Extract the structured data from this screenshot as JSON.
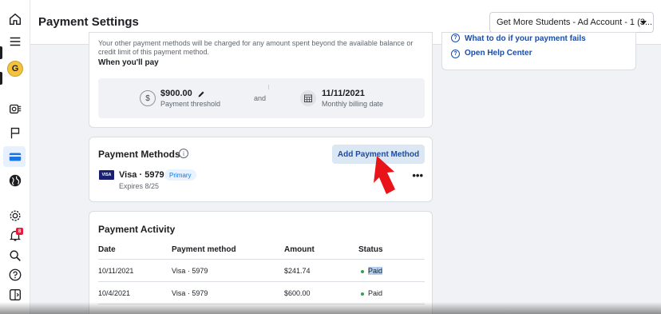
{
  "header": {
    "title": "Payment Settings",
    "account_selector": "Get More Students - Ad Account - 1 (3..."
  },
  "sidebar": {
    "avatar_letter": "G",
    "notification_count": "8"
  },
  "billing": {
    "note": "Your other payment methods will be charged for any amount spent beyond the available balance or credit limit of this payment method.",
    "when_heading": "When you'll pay",
    "threshold_value": "$900.00",
    "threshold_label": "Payment threshold",
    "and_text": "and",
    "date_value": "11/11/2021",
    "date_label": "Monthly billing date"
  },
  "help": {
    "link1": "What to do if your payment fails",
    "link2": "Open Help Center"
  },
  "payment_methods": {
    "title": "Payment Methods",
    "add_button": "Add Payment Method",
    "card_logo": "VISA",
    "card_name": "Visa · 5979",
    "badge": "Primary",
    "expires": "Expires 8/25",
    "more": "•••"
  },
  "activity": {
    "title": "Payment Activity",
    "columns": [
      "Date",
      "Payment method",
      "Amount",
      "Status"
    ],
    "rows": [
      {
        "date": "10/11/2021",
        "method": "Visa · 5979",
        "amount": "$241.74",
        "status": "Paid"
      },
      {
        "date": "10/4/2021",
        "method": "Visa · 5979",
        "amount": "$600.00",
        "status": "Paid"
      }
    ]
  },
  "colors": {
    "accent": "#1b4ca6",
    "arrow": "#e8141a",
    "paid_dot": "#31a24c"
  }
}
